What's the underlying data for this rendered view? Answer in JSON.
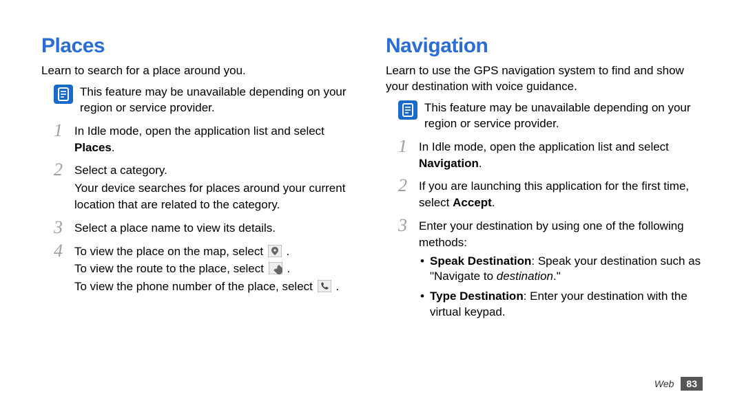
{
  "left": {
    "heading": "Places",
    "intro": "Learn to search for a place around you.",
    "note": "This feature may be unavailable depending on your region or service provider.",
    "steps": {
      "s1": {
        "num": "1",
        "text_a": "In Idle mode, open the application list and select ",
        "bold": "Places",
        "text_b": "."
      },
      "s2": {
        "num": "2",
        "line1": "Select a category.",
        "line2": "Your device searches for places around your current location that are related to the category."
      },
      "s3": {
        "num": "3",
        "text": "Select a place name to view its details."
      },
      "s4": {
        "num": "4",
        "line1a": "To view the place on the map, select ",
        "line1b": " .",
        "line2a": "To view the route to the place, select ",
        "line2b": " .",
        "line3a": "To view the phone number of the place, select ",
        "line3b": " ."
      }
    }
  },
  "right": {
    "heading": "Navigation",
    "intro": "Learn to use the GPS navigation system to find and show your destination with voice guidance.",
    "note": "This feature may be unavailable depending on your region or service provider.",
    "steps": {
      "s1": {
        "num": "1",
        "text_a": "In Idle mode, open the application list and select ",
        "bold": "Navigation",
        "text_b": "."
      },
      "s2": {
        "num": "2",
        "text_a": "If you are launching this application for the first time, select ",
        "bold": "Accept",
        "text_b": "."
      },
      "s3": {
        "num": "3",
        "text": "Enter your destination by using one of the following methods:",
        "bullets": {
          "b1": {
            "bold": "Speak Destination",
            "mid": ": Speak your destination such as \"Navigate to ",
            "italic": "destination",
            "end": ".\""
          },
          "b2": {
            "bold": "Type Destination",
            "rest": ": Enter your destination with the virtual keypad."
          }
        }
      }
    }
  },
  "footer": {
    "label": "Web",
    "page": "83"
  }
}
